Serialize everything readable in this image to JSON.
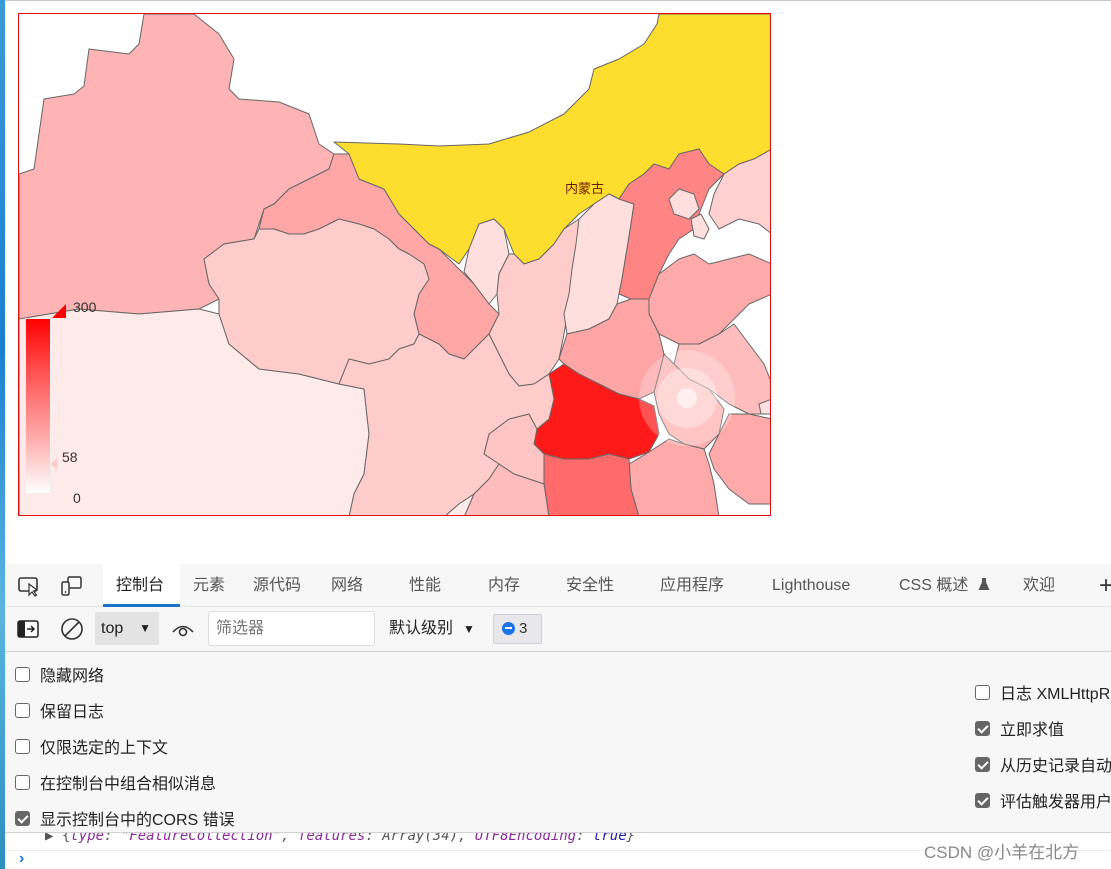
{
  "map": {
    "label_inner_mongolia": "内蒙古",
    "visual_map": {
      "max": "300",
      "current": "58",
      "min": "0",
      "max_value": 300,
      "current_value": 58,
      "min_value": 0
    },
    "colors": {
      "highlight": "#fddd2e",
      "max": "#ff0000",
      "min": "#ffffff",
      "border": "#e01010"
    }
  },
  "devtools": {
    "tabs": [
      {
        "label": "控制台",
        "active": true
      },
      {
        "label": "元素"
      },
      {
        "label": "源代码"
      },
      {
        "label": "网络"
      },
      {
        "label": "性能"
      },
      {
        "label": "内存"
      },
      {
        "label": "安全性"
      },
      {
        "label": "应用程序"
      },
      {
        "label": "Lighthouse"
      },
      {
        "label": "CSS 概述"
      },
      {
        "label": "欢迎"
      }
    ],
    "add_tab": "+",
    "toolbar": {
      "context": "top",
      "filter_placeholder": "筛选器",
      "level": "默认级别",
      "message_count": "3"
    },
    "settings_left": [
      {
        "label": "隐藏网络",
        "checked": false
      },
      {
        "label": "保留日志",
        "checked": false
      },
      {
        "label": "仅限选定的上下文",
        "checked": false
      },
      {
        "label": "在控制台中组合相似消息",
        "checked": false
      },
      {
        "label": "显示控制台中的CORS 错误",
        "checked": true
      }
    ],
    "settings_right": [
      {
        "label": "日志 XMLHttpRequests",
        "checked": false
      },
      {
        "label": "立即求值",
        "checked": true
      },
      {
        "label": "从历史记录自动完成",
        "checked": true
      },
      {
        "label": "评估触发器用户激活",
        "checked": true
      }
    ],
    "console": {
      "log_line": {
        "prefix": "▶ {",
        "k1": "type",
        "v1": "\"FeatureCollection\"",
        "k2": "features",
        "v2": "Array(34)",
        "k3": "UTF8Encoding",
        "v3": "true",
        "suffix": "}"
      },
      "prompt": "›"
    }
  },
  "watermark": "CSDN @小羊在北方"
}
